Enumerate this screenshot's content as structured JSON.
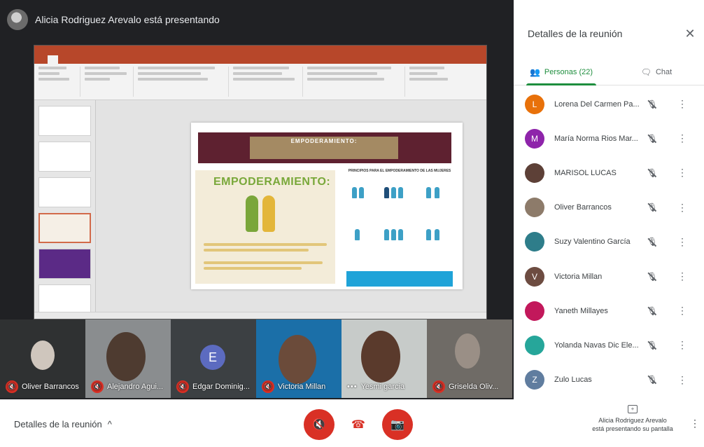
{
  "presenter": {
    "text": "Alicia Rodriguez Arevalo está presentando"
  },
  "slide": {
    "banner_title": "EMPODERAMIENTO:",
    "heading": "EMPODERAMIENTO:",
    "principles_title": "PRINCIPIOS PARA EL EMPODERAMIENTO DE LAS MUJERES"
  },
  "filmstrip": [
    {
      "name": "Oliver Barrancos",
      "type": "video"
    },
    {
      "name": "Alejandro Agui...",
      "type": "video"
    },
    {
      "name": "Edgar Dominig...",
      "type": "avatar",
      "initial": "E"
    },
    {
      "name": "Victoria Millan",
      "type": "video"
    },
    {
      "name": "Yesmi garcia",
      "type": "video"
    },
    {
      "name": "Griselda Oliv...",
      "type": "video"
    }
  ],
  "side_panel": {
    "title": "Detalles de la reunión",
    "close_icon": "close-icon",
    "tabs": [
      {
        "label": "Personas (22)",
        "icon": "people-icon",
        "active": true
      },
      {
        "label": "Chat",
        "icon": "chat-icon",
        "active": false
      }
    ],
    "participants": [
      {
        "name": "Lorena Del Carmen Pa...",
        "initial": "L",
        "color": "#e8710a"
      },
      {
        "name": "María Norma Rios Mar...",
        "initial": "M",
        "color": "#8e24aa"
      },
      {
        "name": "MARISOL LUCAS",
        "initial": "",
        "color": "#5d4037"
      },
      {
        "name": "Oliver Barrancos",
        "initial": "",
        "color": "#8d7b6a"
      },
      {
        "name": "Suzy Valentino García",
        "initial": "",
        "color": "#2e7d8a"
      },
      {
        "name": "Victoria Millan",
        "initial": "V",
        "color": "#6d4c41"
      },
      {
        "name": "Yaneth Millayes",
        "initial": "",
        "color": "#c2185b"
      },
      {
        "name": "Yolanda Navas Dic Ele...",
        "initial": "",
        "color": "#26a69a"
      },
      {
        "name": "Zulo Lucas",
        "initial": "Z",
        "color": "#607d9f"
      }
    ]
  },
  "bottom_bar": {
    "meeting_details": "Detalles de la reunión",
    "chevron": "^",
    "present_text_line1": "Alicia Rodriguez Arevalo",
    "present_text_line2": "está presentando su pantalla"
  },
  "colors": {
    "red": "#d93025",
    "green": "#1e8e3e",
    "dark": "#202124"
  }
}
